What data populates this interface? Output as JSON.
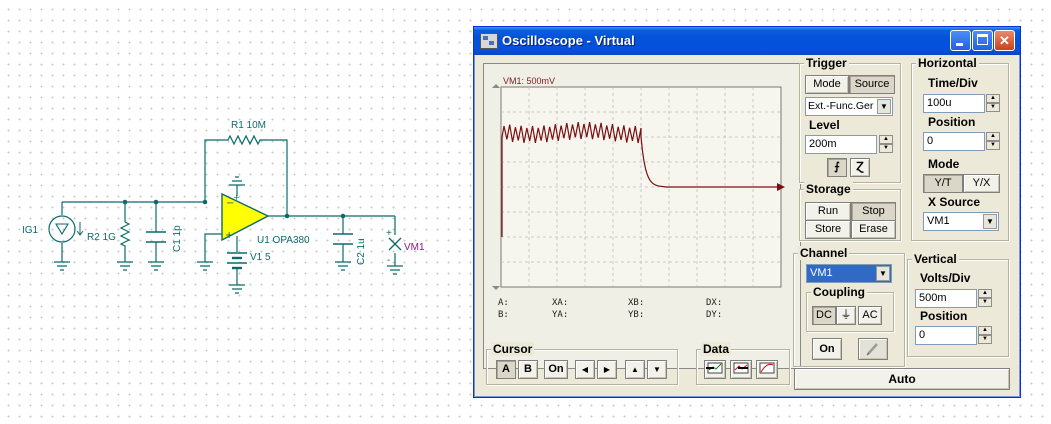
{
  "schematic": {
    "ig1": "IG1",
    "r2": "R2 1G",
    "c1": "C1 1p",
    "r1": "R1 10M",
    "u1": "U1 OPA380",
    "v1": "V1 5",
    "c2": "C2 1u",
    "vm1": "VM1",
    "plus": "+",
    "minus": "-"
  },
  "window": {
    "title": "Oscilloscope - Virtual",
    "min_label": "_",
    "max_label": "□",
    "close_label": "✕"
  },
  "screen": {
    "scale_label": "VM1: 500mV",
    "readouts": {
      "a": "A:",
      "b": "B:",
      "xa": "XA:",
      "ya": "YA:",
      "xb": "XB:",
      "yb": "YB:",
      "dx": "DX:",
      "dy": "DY:"
    }
  },
  "trigger": {
    "title": "Trigger",
    "mode_label": "Mode",
    "source_label": "Source",
    "source_value": "Ext.-Func.Ger",
    "level_label": "Level",
    "level_value": "200m",
    "rise_symbol": "⨍",
    "fall_symbol": "Ɀ"
  },
  "storage": {
    "title": "Storage",
    "run": "Run",
    "stop": "Stop",
    "store": "Store",
    "erase": "Erase"
  },
  "horizontal": {
    "title": "Horizontal",
    "timediv_label": "Time/Div",
    "timediv_value": "100u",
    "position_label": "Position",
    "position_value": "0",
    "mode_label": "Mode",
    "yt": "Y/T",
    "yx": "Y/X",
    "xsource_label": "X Source",
    "xsource_value": "VM1"
  },
  "channel": {
    "title": "Channel",
    "value": "VM1",
    "coupling_title": "Coupling",
    "dc": "DC",
    "gnd": "⏚",
    "ac": "AC",
    "on": "On"
  },
  "vertical": {
    "title": "Vertical",
    "voltsdiv_label": "Volts/Div",
    "voltsdiv_value": "500m",
    "position_label": "Position",
    "position_value": "0"
  },
  "cursor": {
    "title": "Cursor",
    "a": "A",
    "b": "B",
    "on": "On",
    "left": "◀",
    "right": "▶",
    "up": "▲",
    "down": "▼"
  },
  "data": {
    "title": "Data"
  },
  "auto_label": "Auto",
  "colors": {
    "trace": "#7a0f12",
    "opamp_fill": "#ffff00",
    "wire": "#0b6b6b",
    "titlebar": "#0a5de0"
  }
}
